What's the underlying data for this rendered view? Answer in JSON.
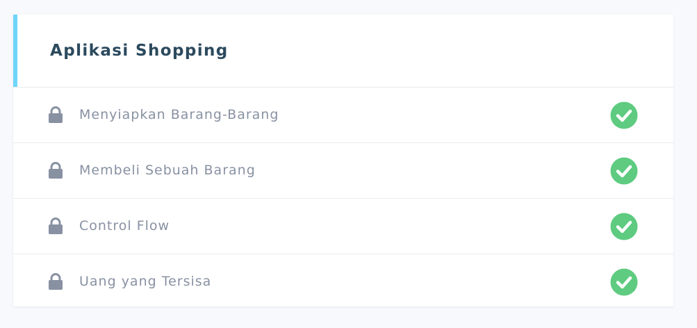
{
  "card": {
    "title": "Aplikasi Shopping",
    "accent_color": "#6fd6f9"
  },
  "lessons": [
    {
      "label": "Menyiapkan Barang-Barang",
      "status_icon": "check-circle-icon",
      "lock_icon": "lock-icon"
    },
    {
      "label": "Membeli Sebuah Barang",
      "status_icon": "check-circle-icon",
      "lock_icon": "lock-icon"
    },
    {
      "label": "Control Flow",
      "status_icon": "check-circle-icon",
      "lock_icon": "lock-icon"
    },
    {
      "label": "Uang yang Tersisa",
      "status_icon": "check-circle-icon",
      "lock_icon": "lock-icon"
    }
  ],
  "colors": {
    "check": "#5ecb80",
    "lock": "#8891a2",
    "title": "#2c4a5e"
  }
}
